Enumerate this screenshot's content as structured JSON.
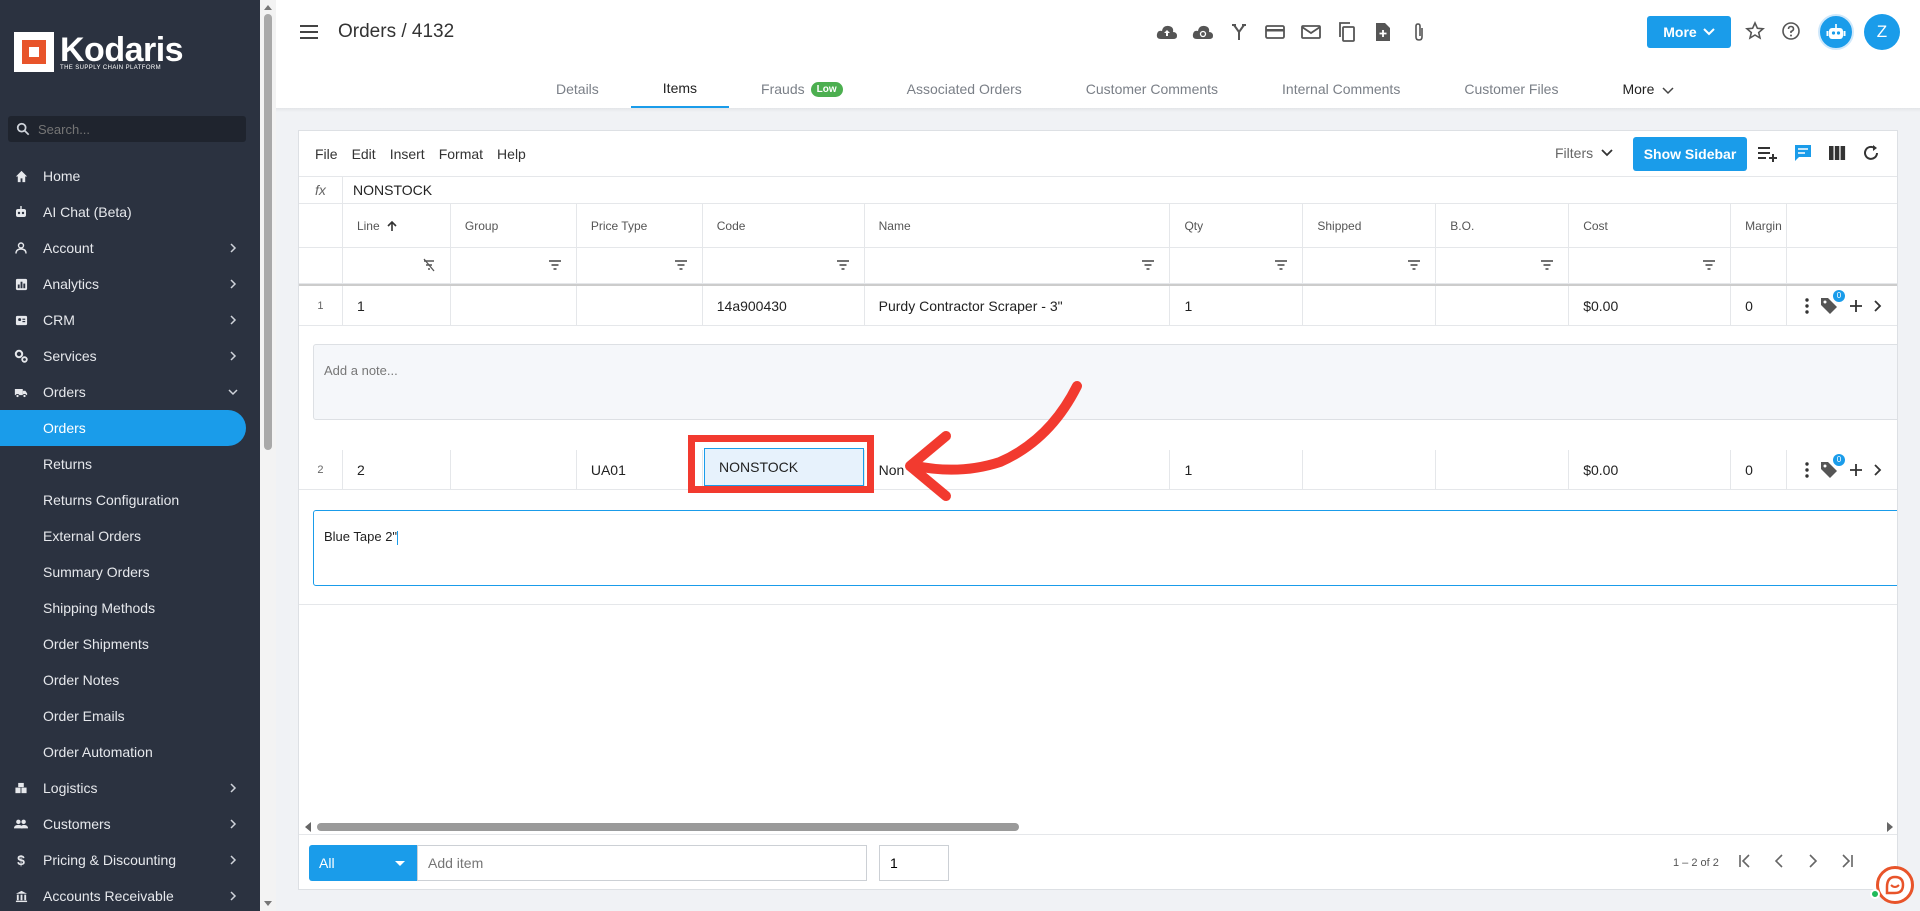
{
  "brand": {
    "name": "Kodaris",
    "tagline": "THE SUPPLY CHAIN PLATFORM"
  },
  "sidebar": {
    "search_placeholder": "Search...",
    "items": [
      {
        "label": "Home",
        "icon": "home-icon"
      },
      {
        "label": "AI Chat (Beta)",
        "icon": "robot-icon"
      },
      {
        "label": "Account",
        "icon": "user-icon"
      },
      {
        "label": "Analytics",
        "icon": "chart-icon"
      },
      {
        "label": "CRM",
        "icon": "contact-icon"
      },
      {
        "label": "Services",
        "icon": "gears-icon"
      },
      {
        "label": "Orders",
        "icon": "truck-icon"
      }
    ],
    "orders_sub": [
      "Orders",
      "Returns",
      "Returns Configuration",
      "External Orders",
      "Summary Orders",
      "Shipping Methods",
      "Order Shipments",
      "Order Notes",
      "Order Emails",
      "Order Automation"
    ],
    "items_after": [
      {
        "label": "Logistics",
        "icon": "boxes-icon"
      },
      {
        "label": "Customers",
        "icon": "people-icon"
      },
      {
        "label": "Pricing & Discounting",
        "icon": "dollar-icon"
      },
      {
        "label": "Accounts Receivable",
        "icon": "bank-icon"
      }
    ]
  },
  "header": {
    "title": "Orders / 4132",
    "more_label": "More",
    "avatar_letter": "Z"
  },
  "tabs": [
    {
      "label": "Details"
    },
    {
      "label": "Items"
    },
    {
      "label": "Frauds",
      "badge": "Low"
    },
    {
      "label": "Associated Orders"
    },
    {
      "label": "Customer Comments"
    },
    {
      "label": "Internal Comments"
    },
    {
      "label": "Customer Files"
    },
    {
      "label": "More"
    }
  ],
  "menubar": [
    "File",
    "Edit",
    "Insert",
    "Format",
    "Help"
  ],
  "toolbar": {
    "filters_label": "Filters",
    "show_sidebar_label": "Show Sidebar"
  },
  "formula": {
    "fx": "fx",
    "value": "NONSTOCK"
  },
  "columns": [
    "Line",
    "Group",
    "Price Type",
    "Code",
    "Name",
    "Qty",
    "Shipped",
    "B.O.",
    "Cost",
    "Margin"
  ],
  "rows": [
    {
      "rownum": "1",
      "line": "1",
      "group": "",
      "price_type": "",
      "code": "14a900430",
      "name": "Purdy Contractor Scraper - 3\"",
      "qty": "1",
      "shipped": "",
      "bo": "",
      "cost": "$0.00",
      "margin": "0",
      "tag_count": "0",
      "note": "Add a note..."
    },
    {
      "rownum": "2",
      "line": "2",
      "group": "",
      "price_type": "UA01",
      "code": "NONSTOCK",
      "name": "Non",
      "qty": "1",
      "shipped": "",
      "bo": "",
      "cost": "$0.00",
      "margin": "0",
      "tag_count": "0",
      "note": "Blue Tape 2\""
    }
  ],
  "footer": {
    "select_label": "All",
    "add_item_placeholder": "Add item",
    "qty_value": "1",
    "pager_text": "1 – 2 of 2"
  },
  "colors": {
    "accent": "#1a9cea",
    "sidebar_bg": "#2b3240",
    "highlight": "#f23a2f",
    "brand_orange": "#e8542a"
  }
}
